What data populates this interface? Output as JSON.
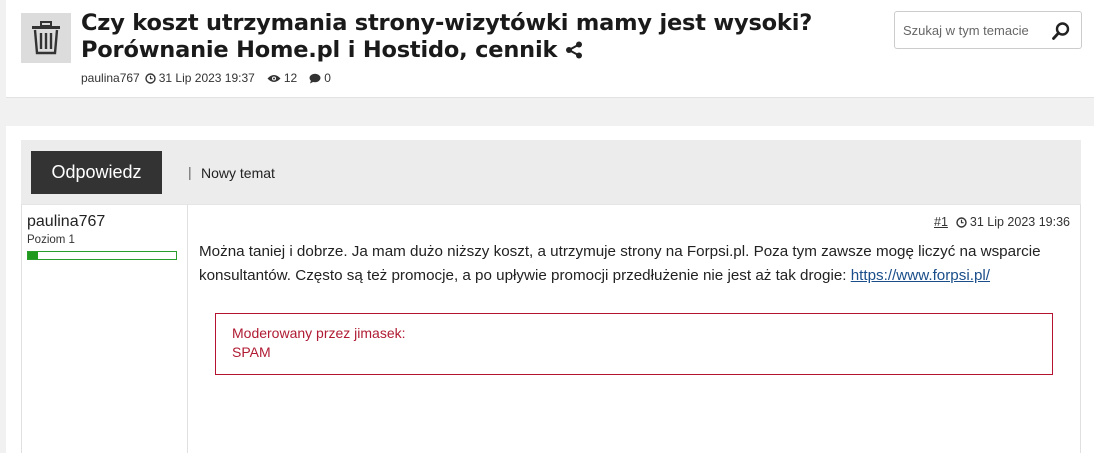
{
  "topic": {
    "title": "Czy koszt utrzymania strony-wizytówki mamy jest wysoki? Porównanie Home.pl i Hostido, cennik",
    "author": "paulina767",
    "date": "31 Lip 2023 19:37",
    "views": "12",
    "comments": "0"
  },
  "search": {
    "placeholder": "Szukaj w tym temacie"
  },
  "toolbar": {
    "reply_label": "Odpowiedz",
    "separator": "|",
    "new_topic_label": "Nowy temat"
  },
  "post": {
    "author_name": "paulina767",
    "author_level": "Poziom 1",
    "level_progress": 0.07,
    "number": "#1",
    "date": "31 Lip 2023 19:36",
    "text_before_link": "Można taniej i dobrze. Ja mam dużo niższy koszt, a utrzymuje strony na Forpsi.pl. Poza tym zawsze mogę liczyć na wsparcie konsultantów. Często są też promocje, a po upływie promocji przedłużenie nie jest aż tak drogie: ",
    "link_text": "https://www.forpsi.pl/",
    "moderation_label": "Moderowany przez jimasek:",
    "moderation_reason": "SPAM"
  },
  "colors": {
    "reply_button": "#333333",
    "moderation": "#b5132f",
    "level_bar": "#1f9a1f"
  },
  "icons": {
    "header": "trash-icon",
    "share": "share-icon",
    "clock": "clock-icon",
    "views": "eye-icon",
    "comments": "comment-icon",
    "search": "search-icon"
  }
}
